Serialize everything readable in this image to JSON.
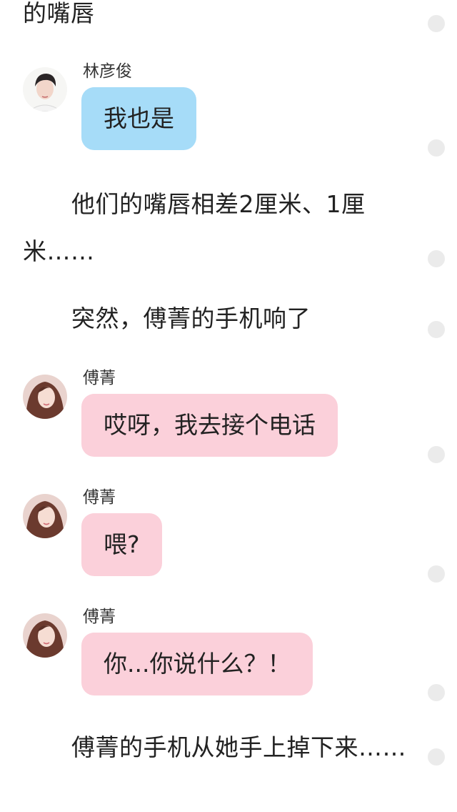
{
  "story": {
    "paragraphs": [
      "的嘴唇",
      "他们的嘴唇相差2厘米、1厘",
      "米……",
      "突然，傅菁的手机响了",
      "傅菁的手机从她手上掉下来……"
    ],
    "messages": [
      {
        "speaker": "林彦俊",
        "text": "我也是",
        "color": "#a6dcf8"
      },
      {
        "speaker": "傅菁",
        "text": "哎呀，我去接个电话",
        "color": "#fbd0da"
      },
      {
        "speaker": "傅菁",
        "text": "喂?",
        "color": "#fbd0da"
      },
      {
        "speaker": "傅菁",
        "text": "你...你说什么？！",
        "color": "#fbd0da"
      }
    ]
  },
  "icons": {
    "comment_marker": "comment-dot-icon",
    "avatar_male": "male-avatar-icon",
    "avatar_female": "female-avatar-icon"
  }
}
